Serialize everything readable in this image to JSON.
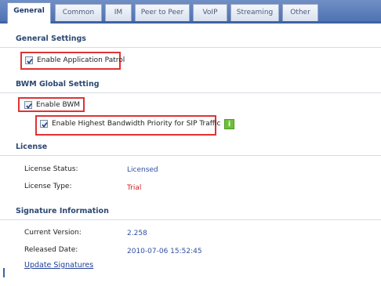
{
  "tabs": [
    {
      "label": "General",
      "active": true
    },
    {
      "label": "Common",
      "active": false
    },
    {
      "label": "IM",
      "active": false
    },
    {
      "label": "Peer to Peer",
      "active": false
    },
    {
      "label": "VoIP",
      "active": false
    },
    {
      "label": "Streaming",
      "active": false
    },
    {
      "label": "Other",
      "active": false
    }
  ],
  "general_settings": {
    "heading": "General Settings",
    "enable_app_patrol": {
      "label": "Enable Application Patrol",
      "checked": true
    }
  },
  "bwm": {
    "heading": "BWM Global Setting",
    "enable_bwm": {
      "label": "Enable BWM",
      "checked": true
    },
    "enable_sip_priority": {
      "label": "Enable Highest Bandwidth Priority for SIP Traffic",
      "checked": true
    },
    "info_icon": "i"
  },
  "license": {
    "heading": "License",
    "status_label": "License Status:",
    "status_value": "Licensed",
    "type_label": "License Type:",
    "type_value": "Trial"
  },
  "signature": {
    "heading": "Signature Information",
    "version_label": "Current Version:",
    "version_value": "2.258",
    "released_label": "Released Date:",
    "released_value": "2010-07-06 15:52:45",
    "update_link": "Update Signatures"
  },
  "colors": {
    "highlight": "#e03333",
    "link": "#1f3f9a",
    "licensed": "#2f4f9f",
    "trial": "#d02020"
  }
}
